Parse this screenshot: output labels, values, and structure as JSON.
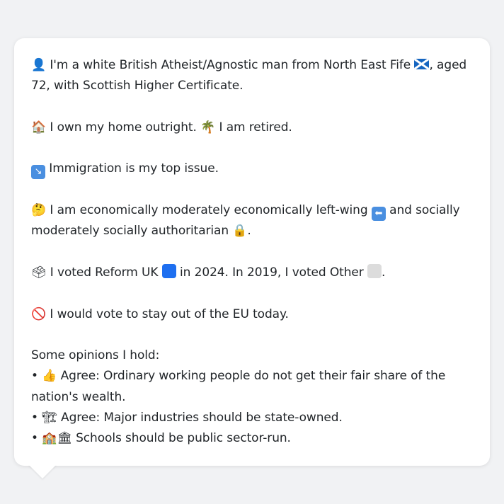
{
  "profile": {
    "identity": {
      "icon_user": "👤",
      "text_a": " I'm a white British Atheist/Agnostic man from North East Fife ",
      "flag_icon": "scotland-flag",
      "text_b": ", aged 72, with Scottish Higher Certificate."
    },
    "home": {
      "icon_house": "🏠",
      "text_a": " I own my home outright. ",
      "icon_palm": "🌴",
      "text_b": " I am retired."
    },
    "issue": {
      "icon": "↘",
      "text": " Immigration is my top issue."
    },
    "ideology": {
      "icon_thinking": "🤔",
      "text_a": " I am economically moderately economically left-wing ",
      "icon_left": "⬅",
      "text_b": " and socially moderately socially authoritarian ",
      "icon_lock": "🔒",
      "text_c": "."
    },
    "vote": {
      "icon_ballot": "🗳",
      "text_a": " I voted Reform UK ",
      "party_color_2024": "#1e6ff0",
      "text_b": " in 2024. In 2019, I voted Other ",
      "party_color_2019": "#dcdcdc",
      "text_c": "."
    },
    "eu": {
      "icon_no": "🚫",
      "text": " I would vote to stay out of the EU today."
    },
    "opinions": {
      "heading": "Some opinions I hold:",
      "items": [
        {
          "bullet": "•",
          "icon": "👍",
          "text": " Agree: Ordinary working people do not get their fair share of the nation's wealth."
        },
        {
          "bullet": "•",
          "icon": "🏗",
          "text": " Agree: Major industries should be state-owned."
        },
        {
          "bullet": "•",
          "icon": "🏫🏛",
          "text": " Schools should be public sector-run."
        }
      ]
    }
  }
}
